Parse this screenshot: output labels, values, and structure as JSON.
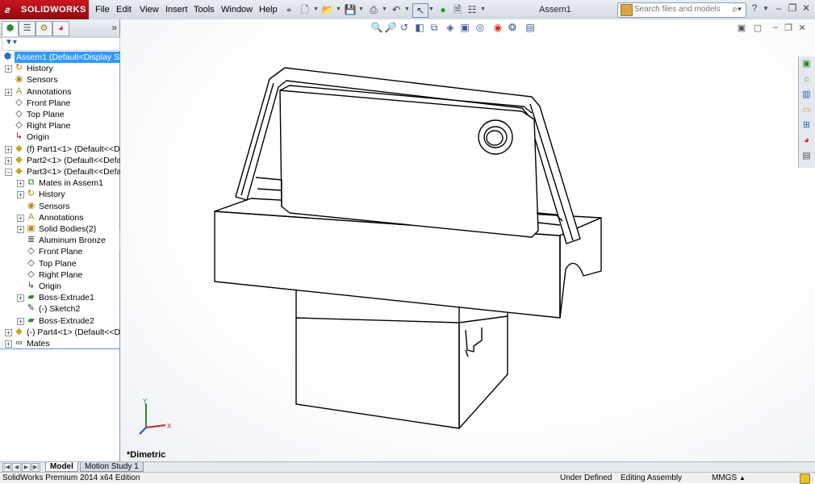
{
  "app": {
    "logo_text": "SOLIDWORKS",
    "document_title": "Assem1"
  },
  "menu": [
    "File",
    "Edit",
    "View",
    "Insert",
    "Tools",
    "Window",
    "Help"
  ],
  "search": {
    "placeholder": "Search files and models"
  },
  "tree": [
    {
      "label": "Assem1  (Default<Display State",
      "icon": "assembly-icon",
      "depth": 0,
      "expander": "",
      "selected": true
    },
    {
      "label": "History",
      "icon": "history-icon",
      "depth": 1,
      "expander": "+"
    },
    {
      "label": "Sensors",
      "icon": "sensors-icon",
      "depth": 1,
      "expander": ""
    },
    {
      "label": "Annotations",
      "icon": "annotations-icon",
      "depth": 1,
      "expander": "+"
    },
    {
      "label": "Front Plane",
      "icon": "plane-icon",
      "depth": 1,
      "expander": ""
    },
    {
      "label": "Top Plane",
      "icon": "plane-icon",
      "depth": 1,
      "expander": ""
    },
    {
      "label": "Right Plane",
      "icon": "plane-icon",
      "depth": 1,
      "expander": ""
    },
    {
      "label": "Origin",
      "icon": "origin-icon",
      "depth": 1,
      "expander": ""
    },
    {
      "label": "(f) Part1<1> (Default<<Defa",
      "icon": "part-icon",
      "depth": 1,
      "expander": "+"
    },
    {
      "label": "Part2<1> (Default<<Default",
      "icon": "part-icon",
      "depth": 1,
      "expander": "+"
    },
    {
      "label": "Part3<1> (Default<<Default",
      "icon": "part-icon",
      "depth": 1,
      "expander": "−"
    },
    {
      "label": "Mates in Assem1",
      "icon": "mates-in-assembly-icon",
      "depth": 2,
      "expander": "+"
    },
    {
      "label": "History",
      "icon": "history-icon",
      "depth": 2,
      "expander": "+"
    },
    {
      "label": "Sensors",
      "icon": "sensors-icon",
      "depth": 2,
      "expander": ""
    },
    {
      "label": "Annotations",
      "icon": "annotations-icon",
      "depth": 2,
      "expander": "+"
    },
    {
      "label": "Solid Bodies(2)",
      "icon": "solid-bodies-icon",
      "depth": 2,
      "expander": "+"
    },
    {
      "label": "Aluminum Bronze",
      "icon": "material-icon",
      "depth": 2,
      "expander": ""
    },
    {
      "label": "Front Plane",
      "icon": "plane-icon",
      "depth": 2,
      "expander": ""
    },
    {
      "label": "Top Plane",
      "icon": "plane-icon",
      "depth": 2,
      "expander": ""
    },
    {
      "label": "Right Plane",
      "icon": "plane-icon",
      "depth": 2,
      "expander": ""
    },
    {
      "label": "Origin",
      "icon": "origin-icon",
      "depth": 2,
      "expander": ""
    },
    {
      "label": "Boss-Extrude1",
      "icon": "extrude-icon",
      "depth": 2,
      "expander": "+"
    },
    {
      "label": "(-) Sketch2",
      "icon": "sketch-icon",
      "depth": 2,
      "expander": ""
    },
    {
      "label": "Boss-Extrude2",
      "icon": "extrude-icon",
      "depth": 2,
      "expander": "+"
    },
    {
      "label": "(-) Part4<1> (Default<<Def",
      "icon": "part-icon",
      "depth": 1,
      "expander": "+"
    },
    {
      "label": "Mates",
      "icon": "mates-icon",
      "depth": 1,
      "expander": "+"
    }
  ],
  "graphics": {
    "view_label": "*Dimetric",
    "triad": {
      "x": "X",
      "y": "Y"
    }
  },
  "bottom_tabs": [
    "Model",
    "Motion Study 1"
  ],
  "status": {
    "edition": "SolidWorks Premium 2014 x64 Edition",
    "state": "Under Defined",
    "mode": "Editing Assembly",
    "units": "MMGS"
  },
  "colors": {
    "selection": "#3399ff",
    "brand": "#c9161e"
  }
}
